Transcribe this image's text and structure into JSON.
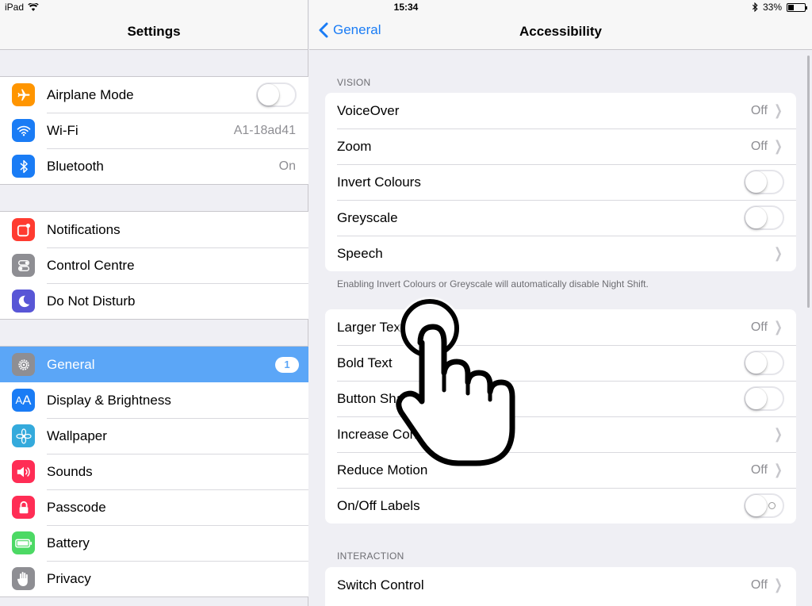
{
  "status": {
    "device": "iPad",
    "time": "15:34",
    "battery": "33%",
    "battery_level": 0.33
  },
  "master": {
    "title": "Settings",
    "group1": [
      {
        "label": "Airplane Mode",
        "value": "",
        "icon": "airplane-icon",
        "color": "#ff9500"
      },
      {
        "label": "Wi-Fi",
        "value": "A1-18ad41",
        "icon": "wifi-icon",
        "color": "#1a7cf5"
      },
      {
        "label": "Bluetooth",
        "value": "On",
        "icon": "bluetooth-icon",
        "color": "#1a7cf5"
      }
    ],
    "group2": [
      {
        "label": "Notifications",
        "icon": "notifications-icon",
        "color": "#ff3b30"
      },
      {
        "label": "Control Centre",
        "icon": "control-centre-icon",
        "color": "#8e8e93"
      },
      {
        "label": "Do Not Disturb",
        "icon": "moon-icon",
        "color": "#5856d6"
      }
    ],
    "group3": [
      {
        "label": "General",
        "badge": "1",
        "icon": "gear-icon",
        "color": "#8e8e93"
      },
      {
        "label": "Display & Brightness",
        "icon": "display-icon",
        "color": "#1a7cf5"
      },
      {
        "label": "Wallpaper",
        "icon": "flower-icon",
        "color": "#34aadc"
      },
      {
        "label": "Sounds",
        "icon": "speaker-icon",
        "color": "#ff2d55"
      },
      {
        "label": "Passcode",
        "icon": "lock-icon",
        "color": "#ff2d55"
      },
      {
        "label": "Battery",
        "icon": "battery-icon",
        "color": "#4cd964"
      },
      {
        "label": "Privacy",
        "icon": "hand-icon",
        "color": "#8e8e93"
      }
    ]
  },
  "detail": {
    "back": "General",
    "title": "Accessibility",
    "vision_header": "VISION",
    "vision": [
      {
        "label": "VoiceOver",
        "value": "Off"
      },
      {
        "label": "Zoom",
        "value": "Off"
      },
      {
        "label": "Invert Colours"
      },
      {
        "label": "Greyscale"
      },
      {
        "label": "Speech"
      }
    ],
    "vision_note": "Enabling Invert Colours or Greyscale will automatically disable Night Shift.",
    "display": [
      {
        "label": "Larger Text",
        "value": "Off"
      },
      {
        "label": "Bold Text"
      },
      {
        "label": "Button Shapes"
      },
      {
        "label": "Increase Contrast"
      },
      {
        "label": "Reduce Motion",
        "value": "Off"
      },
      {
        "label": "On/Off Labels"
      }
    ],
    "interaction_header": "INTERACTION",
    "interaction": [
      {
        "label": "Switch Control",
        "value": "Off"
      }
    ]
  }
}
